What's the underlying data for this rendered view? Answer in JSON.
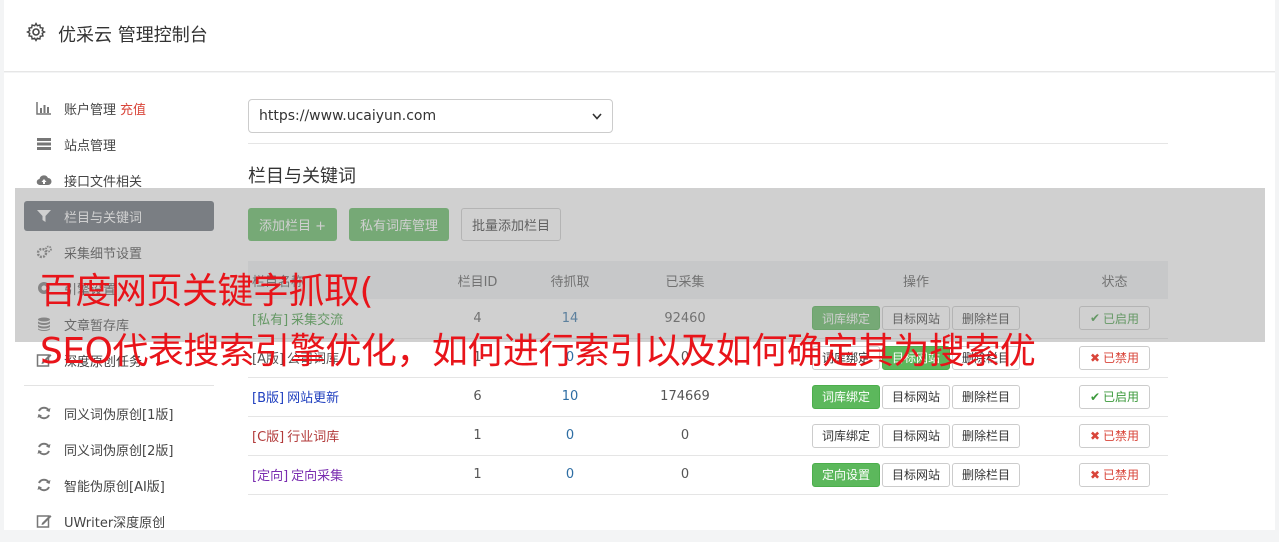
{
  "header": {
    "title": "优采云 管理控制台",
    "icon": "gear-icon"
  },
  "sidebar": {
    "group1": [
      {
        "label": "账户管理",
        "extra": "充值",
        "icon": "bar-chart-icon"
      },
      {
        "label": "站点管理",
        "icon": "server-icon"
      },
      {
        "label": "接口文件相关",
        "icon": "cloud-upload-icon"
      },
      {
        "label": "栏目与关键词",
        "icon": "filter-icon",
        "active": true
      },
      {
        "label": "采集细节设置",
        "icon": "cogs-icon"
      },
      {
        "label": "引擎设置",
        "icon": "circle-icon"
      },
      {
        "label": "文章暂存库",
        "icon": "database-icon"
      },
      {
        "label": "深度原创任务",
        "icon": "edit-icon"
      }
    ],
    "group2": [
      {
        "label": "同义词伪原创[1版]",
        "icon": "refresh-icon"
      },
      {
        "label": "同义词伪原创[2版]",
        "icon": "refresh-icon"
      },
      {
        "label": "智能伪原创[AI版]",
        "icon": "refresh-icon"
      },
      {
        "label": "UWriter深度原创",
        "icon": "pencil-icon"
      }
    ]
  },
  "site_select": {
    "value": "https://www.ucaiyun.com"
  },
  "section_title": "栏目与关键词",
  "buttons": {
    "add": "添加栏目 +",
    "private": "私有词库管理",
    "batch": "批量添加栏目"
  },
  "table": {
    "headers": [
      "栏目名称",
      "栏目ID",
      "待抓取",
      "已采集",
      "操作",
      "状态"
    ],
    "rows": [
      {
        "tag": "[私有]",
        "name": "采集交流",
        "id": "4",
        "pending": "14",
        "collected": "92460",
        "op1": "词库绑定",
        "op1_green": true,
        "op2": "目标网站",
        "op2_green": false,
        "op3": "删除栏目",
        "status": "已启用",
        "on": true,
        "color": "#3c9a3c"
      },
      {
        "tag": "[A版]",
        "name": "公司词库",
        "id": "1",
        "pending": "0",
        "collected": "0",
        "op1": "词库绑定",
        "op1_green": false,
        "op2": "目标网站",
        "op2_green": true,
        "op3": "删除栏目",
        "status": "已禁用",
        "on": false,
        "color": "#555555"
      },
      {
        "tag": "[B版]",
        "name": "网站更新",
        "id": "6",
        "pending": "10",
        "collected": "174669",
        "op1": "词库绑定",
        "op1_green": true,
        "op2": "目标网站",
        "op2_green": false,
        "op3": "删除栏目",
        "status": "已启用",
        "on": true,
        "color": "#1f3fbf"
      },
      {
        "tag": "[C版]",
        "name": "行业词库",
        "id": "1",
        "pending": "0",
        "collected": "0",
        "op1": "词库绑定",
        "op1_green": false,
        "op2": "目标网站",
        "op2_green": false,
        "op3": "删除栏目",
        "status": "已禁用",
        "on": false,
        "color": "#b23a3a"
      },
      {
        "tag": "[定向]",
        "name": "定向采集",
        "id": "1",
        "pending": "0",
        "collected": "0",
        "op1": "定向设置",
        "op1_green": true,
        "op2": "目标网站",
        "op2_green": false,
        "op3": "删除栏目",
        "status": "已禁用",
        "on": false,
        "color": "#7a2db0"
      }
    ]
  },
  "overlay": {
    "line1": "百度网页关键字抓取(",
    "line2": "SEO代表搜索引擎优化，如何进行索引以及如何确定其为搜索优"
  }
}
